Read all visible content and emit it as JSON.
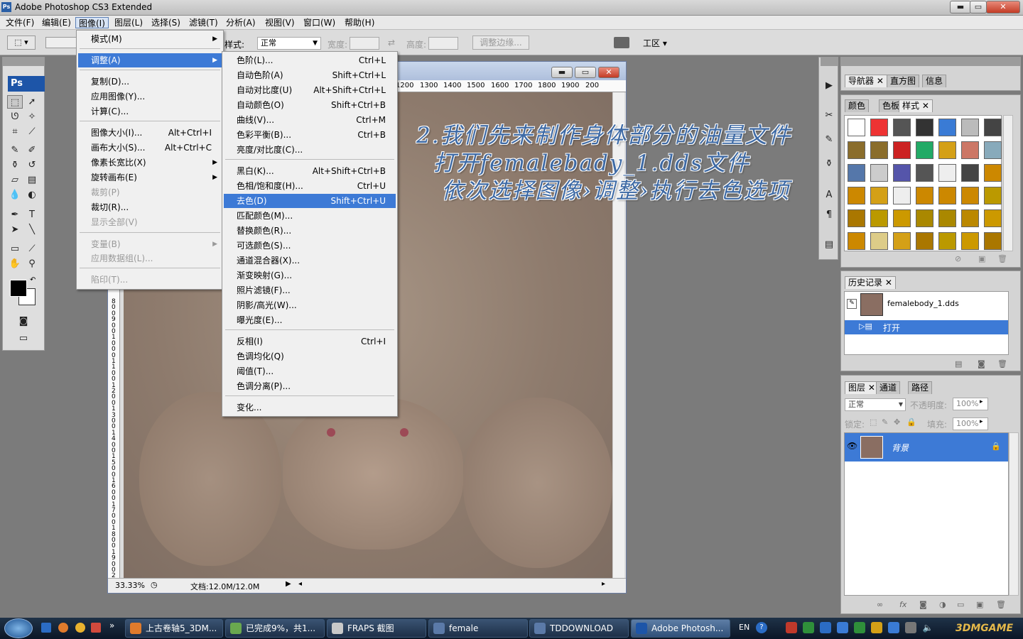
{
  "window": {
    "title": "Adobe Photoshop CS3 Extended"
  },
  "menubar": [
    "文件(F)",
    "编辑(E)",
    "图像(I)",
    "图层(L)",
    "选择(S)",
    "滤镜(T)",
    "分析(A)",
    "视图(V)",
    "窗口(W)",
    "帮助(H)"
  ],
  "options": {
    "style_label": "样式:",
    "style_value": "正常",
    "width_label": "宽度:",
    "height_label": "高度:",
    "refine_button": "调整边缘...",
    "workspace_label": "工区"
  },
  "image_menu": {
    "items": [
      {
        "label": "模式(M)",
        "shortcut": "",
        "submenu": true,
        "disabled": false,
        "highlight": false
      },
      {
        "label": "调整(A)",
        "shortcut": "",
        "submenu": true,
        "disabled": false,
        "highlight": true
      },
      {
        "label": "复制(D)...",
        "shortcut": "",
        "submenu": false,
        "disabled": false,
        "highlight": false
      },
      {
        "label": "应用图像(Y)...",
        "shortcut": "",
        "submenu": false,
        "disabled": false,
        "highlight": false
      },
      {
        "label": "计算(C)...",
        "shortcut": "",
        "submenu": false,
        "disabled": false,
        "highlight": false
      },
      {
        "label": "图像大小(I)...",
        "shortcut": "Alt+Ctrl+I",
        "submenu": false,
        "disabled": false,
        "highlight": false
      },
      {
        "label": "画布大小(S)...",
        "shortcut": "Alt+Ctrl+C",
        "submenu": false,
        "disabled": false,
        "highlight": false
      },
      {
        "label": "像素长宽比(X)",
        "shortcut": "",
        "submenu": true,
        "disabled": false,
        "highlight": false
      },
      {
        "label": "旋转画布(E)",
        "shortcut": "",
        "submenu": true,
        "disabled": false,
        "highlight": false
      },
      {
        "label": "裁剪(P)",
        "shortcut": "",
        "submenu": false,
        "disabled": true,
        "highlight": false
      },
      {
        "label": "裁切(R)...",
        "shortcut": "",
        "submenu": false,
        "disabled": false,
        "highlight": false
      },
      {
        "label": "显示全部(V)",
        "shortcut": "",
        "submenu": false,
        "disabled": true,
        "highlight": false
      },
      {
        "label": "变量(B)",
        "shortcut": "",
        "submenu": true,
        "disabled": true,
        "highlight": false
      },
      {
        "label": "应用数据组(L)...",
        "shortcut": "",
        "submenu": false,
        "disabled": true,
        "highlight": false
      },
      {
        "label": "陷印(T)...",
        "shortcut": "",
        "submenu": false,
        "disabled": true,
        "highlight": false
      }
    ]
  },
  "adjust_menu": {
    "items": [
      {
        "label": "色阶(L)...",
        "shortcut": "Ctrl+L",
        "highlight": false
      },
      {
        "label": "自动色阶(A)",
        "shortcut": "Shift+Ctrl+L",
        "highlight": false
      },
      {
        "label": "自动对比度(U)",
        "shortcut": "Alt+Shift+Ctrl+L",
        "highlight": false
      },
      {
        "label": "自动颜色(O)",
        "shortcut": "Shift+Ctrl+B",
        "highlight": false
      },
      {
        "label": "曲线(V)...",
        "shortcut": "Ctrl+M",
        "highlight": false
      },
      {
        "label": "色彩平衡(B)...",
        "shortcut": "Ctrl+B",
        "highlight": false
      },
      {
        "label": "亮度/对比度(C)...",
        "shortcut": "",
        "highlight": false
      },
      {
        "label": "黑白(K)...",
        "shortcut": "Alt+Shift+Ctrl+B",
        "highlight": false
      },
      {
        "label": "色相/饱和度(H)...",
        "shortcut": "Ctrl+U",
        "highlight": false
      },
      {
        "label": "去色(D)",
        "shortcut": "Shift+Ctrl+U",
        "highlight": true
      },
      {
        "label": "匹配颜色(M)...",
        "shortcut": "",
        "highlight": false
      },
      {
        "label": "替换颜色(R)...",
        "shortcut": "",
        "highlight": false
      },
      {
        "label": "可选颜色(S)...",
        "shortcut": "",
        "highlight": false
      },
      {
        "label": "通道混合器(X)...",
        "shortcut": "",
        "highlight": false
      },
      {
        "label": "渐变映射(G)...",
        "shortcut": "",
        "highlight": false
      },
      {
        "label": "照片滤镜(F)...",
        "shortcut": "",
        "highlight": false
      },
      {
        "label": "阴影/高光(W)...",
        "shortcut": "",
        "highlight": false
      },
      {
        "label": "曝光度(E)...",
        "shortcut": "",
        "highlight": false
      },
      {
        "label": "反相(I)",
        "shortcut": "Ctrl+I",
        "highlight": false
      },
      {
        "label": "色调均化(Q)",
        "shortcut": "",
        "highlight": false
      },
      {
        "label": "阈值(T)...",
        "shortcut": "",
        "highlight": false
      },
      {
        "label": "色调分离(P)...",
        "shortcut": "",
        "highlight": false
      },
      {
        "label": "变化...",
        "shortcut": "",
        "highlight": false
      }
    ]
  },
  "document": {
    "ruler_ticks": [
      "1200",
      "1300",
      "1400",
      "1500",
      "1600",
      "1700",
      "1800",
      "1900",
      "200"
    ],
    "ruler_left_ticks": [
      "8",
      "0",
      "0",
      "9",
      "0",
      "0",
      "1",
      "0",
      "0",
      "0",
      "1",
      "1",
      "0",
      "0",
      "1",
      "2",
      "0",
      "0",
      "1",
      "3",
      "0",
      "0",
      "1",
      "4",
      "0",
      "0",
      "1",
      "5",
      "0",
      "0",
      "1",
      "6",
      "0",
      "0",
      "1",
      "7",
      "0",
      "0",
      "1",
      "8",
      "0",
      "0",
      "1",
      "9",
      "0",
      "0",
      "2"
    ],
    "zoom": "33.33%",
    "doc_info": "文档:12.0M/12.0M"
  },
  "annotation": {
    "lines": [
      "2.我们先来制作身体部分的油量文件",
      "  打开femalebady_1.dds文件",
      "   依次选择图像›调整›执行去色选项"
    ]
  },
  "panels": {
    "nav_tabs": [
      "导航器",
      "直方图",
      "信息"
    ],
    "style_tabs": [
      "颜色",
      "色板",
      "样式"
    ],
    "history_tab": "历史记录",
    "history_items": [
      "femalebody_1.dds",
      "打开"
    ],
    "layer_tabs": [
      "图层",
      "通道",
      "路径"
    ],
    "blend_mode": "正常",
    "opacity_label": "不透明度:",
    "opacity_value": "100%",
    "lock_label": "锁定:",
    "fill_label": "填充:",
    "fill_value": "100%",
    "layer_name": "背景"
  },
  "taskbar": {
    "items": [
      "上古卷轴5_3DM...",
      "已完成9%，共1...",
      "FRAPS 截图",
      "female",
      "TDDOWNLOAD",
      "Adobe Photosh..."
    ],
    "lang": "EN",
    "watermark": "3DMGAME"
  },
  "colors": {
    "highlight": "#3d7ad6",
    "annotation": "#3e6aa5",
    "taskbar": "#1f3248"
  }
}
